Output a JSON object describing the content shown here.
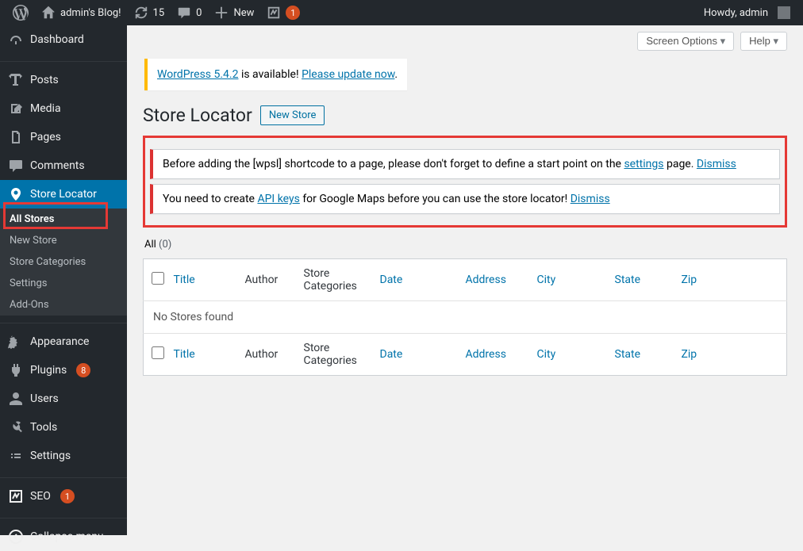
{
  "adminbar": {
    "site_name": "admin's Blog!",
    "updates": "15",
    "comments": "0",
    "new_label": "New",
    "seo_badge": "1",
    "howdy": "Howdy, admin"
  },
  "sidebar": {
    "dashboard": "Dashboard",
    "posts": "Posts",
    "media": "Media",
    "pages": "Pages",
    "comments": "Comments",
    "store_locator": "Store Locator",
    "submenu": {
      "all_stores": "All Stores",
      "new_store": "New Store",
      "store_categories": "Store Categories",
      "settings": "Settings",
      "addons": "Add-Ons"
    },
    "appearance": "Appearance",
    "plugins": "Plugins",
    "plugins_badge": "8",
    "users": "Users",
    "tools": "Tools",
    "settings": "Settings",
    "seo": "SEO",
    "seo_badge": "1",
    "collapse": "Collapse menu"
  },
  "top_buttons": {
    "screen_options": "Screen Options",
    "help": "Help"
  },
  "update_nag": {
    "prefix": "WordPress 5.4.2",
    "mid": " is available! ",
    "link": "Please update now",
    "suffix": "."
  },
  "page": {
    "title": "Store Locator",
    "new_store": "New Store"
  },
  "notices": {
    "n1_pre": "Before adding the [wpsl] shortcode to a page, please don't forget to define a start point on the ",
    "n1_link": "settings",
    "n1_post": " page. ",
    "n2_pre": "You need to create ",
    "n2_link": "API keys",
    "n2_post": " for Google Maps before you can use the store locator! ",
    "dismiss": "Dismiss"
  },
  "filter": {
    "all_label": "All",
    "all_count": "(0)"
  },
  "table": {
    "cols": {
      "title": "Title",
      "author": "Author",
      "categories": "Store Categories",
      "date": "Date",
      "address": "Address",
      "city": "City",
      "state": "State",
      "zip": "Zip"
    },
    "empty": "No Stores found"
  }
}
